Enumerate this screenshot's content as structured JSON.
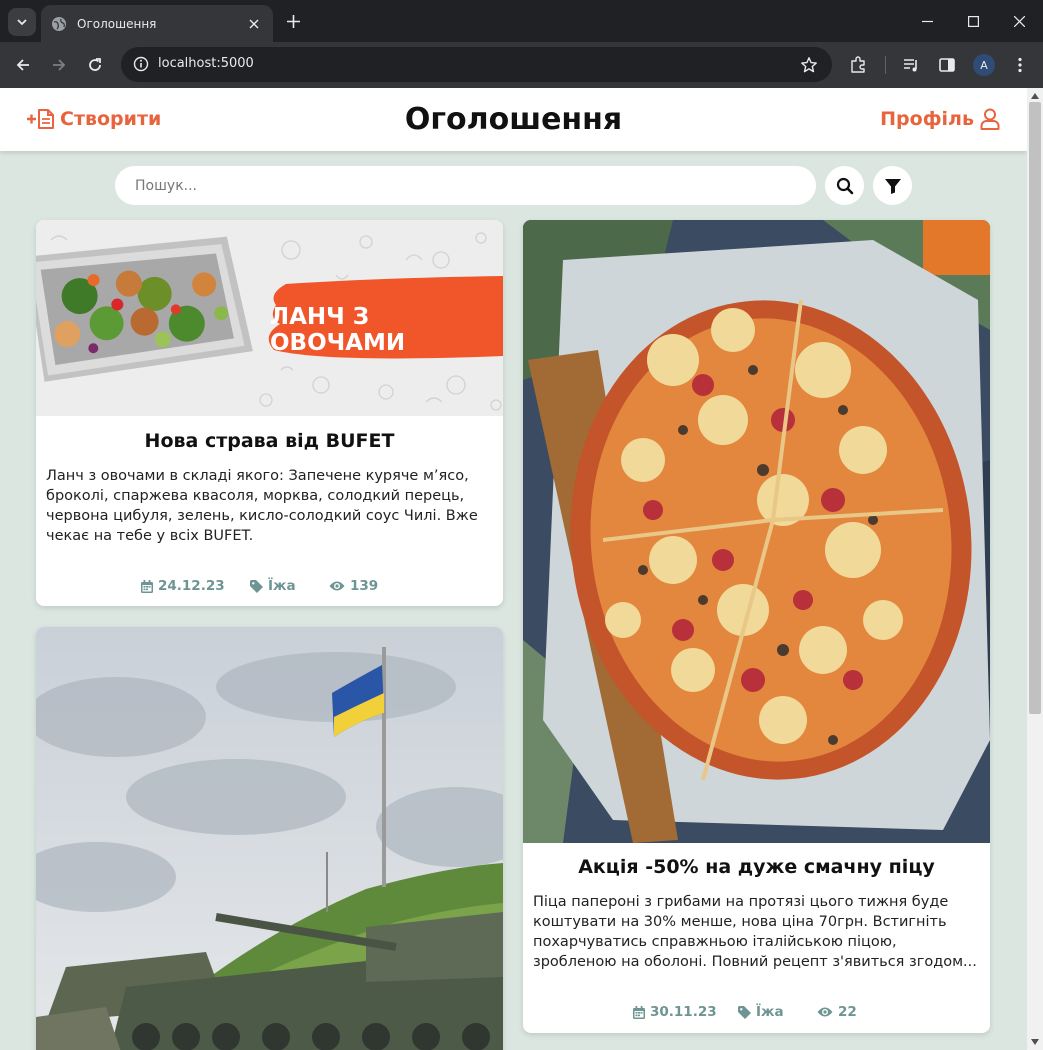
{
  "browser": {
    "tab_title": "Оголошення",
    "url": "localhost:5000",
    "profile_initial": "A"
  },
  "header": {
    "create_label": "Створити",
    "title": "Оголошення",
    "profile_label": "Профіль"
  },
  "search": {
    "placeholder": "Пошук..."
  },
  "posts": [
    {
      "title": "Нова страва від BUFET",
      "image_caption": "ЛАНЧ З ОВОЧАМИ",
      "text": "Ланч з овочами в складі якого: Запечене куряче м’ясо, броколі, спаржева квасоля, морква, солодкий перець, червона цибуля, зелень, кисло-солодкий соус Чилі. Вже чекає на тебе у всіх BUFET.",
      "date": "24.12.23",
      "category": "Їжа",
      "views": "139"
    },
    {
      "title": "Акція -50% на дуже смачну піцу",
      "text": "Піца папероні з грибами на протязі цього тижня буде коштувати на 30% менше, нова ціна 70грн. Встигніть похарчуватись справжньою італійською піцою, зробленою на оболоні. Повний рецепт з'явиться згодом...",
      "date": "30.11.23",
      "category": "Їжа",
      "views": "22"
    }
  ],
  "colors": {
    "accent": "#e8643c",
    "meta": "#6e9494",
    "page_bg": "#dbe6e0"
  }
}
